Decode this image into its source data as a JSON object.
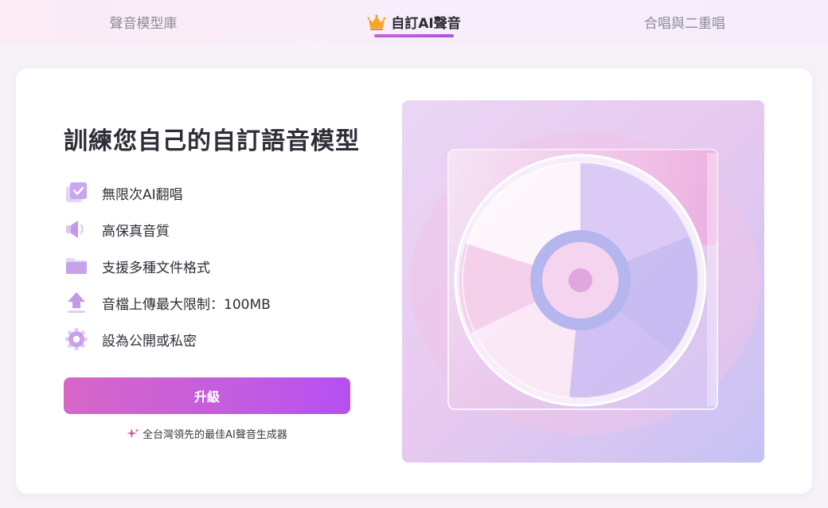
{
  "tabs": [
    {
      "label": "聲音模型庫",
      "active": false
    },
    {
      "label": "自訂AI聲音",
      "active": true,
      "icon": "crown-icon"
    },
    {
      "label": "合唱與二重唱",
      "active": false
    }
  ],
  "main": {
    "title": "訓練您自己的自訂語音模型",
    "features": [
      {
        "icon": "checkbox-stack-icon",
        "label": "無限次AI翻唱"
      },
      {
        "icon": "speaker-icon",
        "label": "高保真音質"
      },
      {
        "icon": "folder-icon",
        "label": "支援多種文件格式"
      },
      {
        "icon": "upload-icon",
        "label": "音檔上傳最大限制：100MB"
      },
      {
        "icon": "gear-icon",
        "label": "設為公開或私密"
      }
    ],
    "upgrade_label": "升級",
    "tagline": "全台灣領先的最佳AI聲音生成器"
  },
  "colors": {
    "accent": "#c35de0",
    "accent_pink": "#d766c7",
    "title_text": "#2e2e38",
    "inactive_tab": "#8c8c96"
  }
}
